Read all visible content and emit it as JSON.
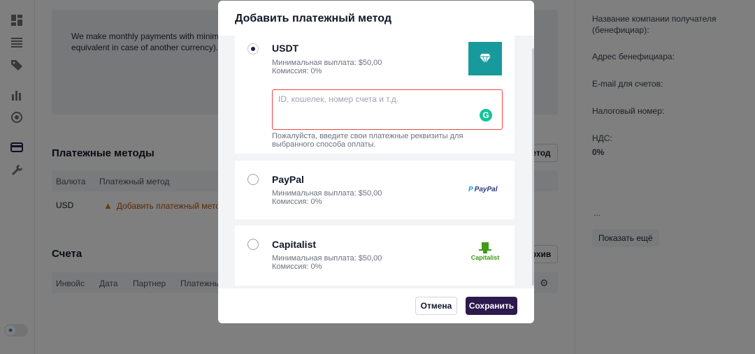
{
  "main": {
    "info_text": "We make monthly payments with minimal ... equivalent in case of another currency).",
    "info_text_lines": [
      "We make monthly payments with minimal",
      "equivalent in case of another currency)."
    ],
    "payment_methods_title": "Платежные методы",
    "payment_methods_button": "етод",
    "payment_table": {
      "headers": [
        "Валюта",
        "Платежный метод"
      ],
      "rows": [
        {
          "currency": "USD",
          "method": "Добавить платежный метод"
        }
      ]
    },
    "invoices_title": "Счета",
    "archive_button": "рхив",
    "invoices_table": {
      "headers": [
        "Инвойс",
        "Дата",
        "Партнер",
        "Платежны"
      ]
    }
  },
  "right_panel": {
    "fields": [
      {
        "label": "Название компании получателя (бенефициар):"
      },
      {
        "label": "Адрес бенефициара:"
      },
      {
        "label": "E-mail для счетов:"
      },
      {
        "label": "Налоговый номер:"
      },
      {
        "label": "НДС:",
        "value": "0%"
      }
    ],
    "dots": "...",
    "show_more": "Показать ещё"
  },
  "modal": {
    "title": "Добавить платежный метод",
    "methods": [
      {
        "name": "USDT",
        "min_payout": "Минимальная выплата: $50,00",
        "commission": "Комиссия: 0%",
        "selected": true,
        "logo_icon": "diamond-icon",
        "logo_color": "#179a9c",
        "input_placeholder": "ID, кошелек, номер счета и т.д.",
        "input_value": "",
        "hint": "Пожалуйста, введите свои платежные реквизиты для выбранного способа оплаты."
      },
      {
        "name": "PayPal",
        "min_payout": "Минимальная выплата: $50,00",
        "commission": "Комиссия: 0%",
        "selected": false,
        "logo_text": "PayPal"
      },
      {
        "name": "Capitalist",
        "min_payout": "Минимальная выплата: $50,00",
        "commission": "Комиссия: 0%",
        "selected": false,
        "logo_text": "Capitalist"
      }
    ],
    "cancel_label": "Отмена",
    "save_label": "Сохранить"
  },
  "colors": {
    "primary": "#2c1a4d",
    "warning": "#b45309",
    "error_border": "#ef4444",
    "usdt_logo": "#179a9c"
  }
}
